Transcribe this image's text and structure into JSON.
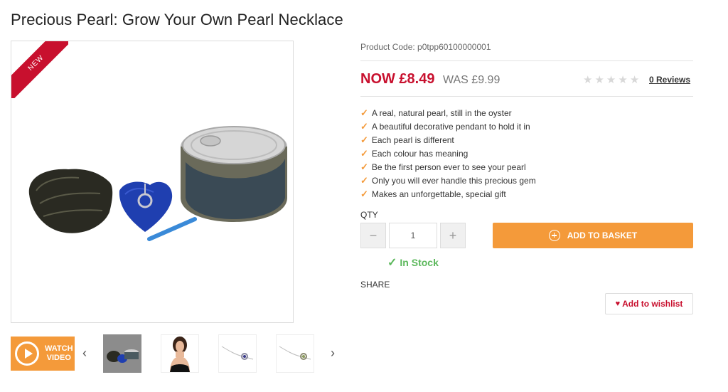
{
  "product": {
    "title": "Precious Pearl: Grow Your Own Pearl Necklace",
    "badge": "NEW",
    "code_label": "Product Code: p0tpp60100000001"
  },
  "pricing": {
    "now": "NOW £8.49",
    "was": "WAS £9.99",
    "rating": 0,
    "reviews_link": "0 Reviews"
  },
  "features": [
    "A real, natural pearl, still in the oyster",
    "A beautiful decorative pendant to hold it in",
    "Each pearl is different",
    "Each colour has meaning",
    "Be the first person ever to see your pearl",
    "Only you will ever handle this precious gem",
    "Makes an unforgettable, special gift"
  ],
  "purchase": {
    "qty_label": "QTY",
    "qty_value": "1",
    "minus": "−",
    "plus": "+",
    "add_to_basket": "ADD TO BASKET",
    "stock": "In Stock"
  },
  "share_label": "SHARE",
  "wishlist_label": "Add to wishlist",
  "gallery": {
    "watch_line1": "WATCH",
    "watch_line2": "VIDEO",
    "prev_icon": "‹",
    "next_icon": "›"
  },
  "colors": {
    "accent_orange": "#f49a3a",
    "price_red": "#c8102e",
    "stock_green": "#5cb85c"
  }
}
